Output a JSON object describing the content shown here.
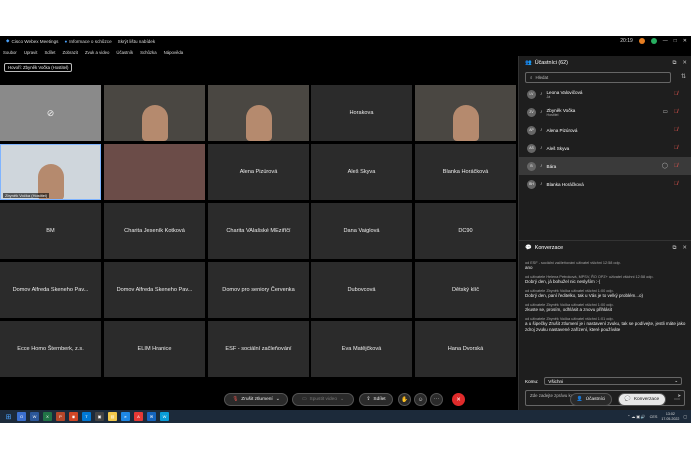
{
  "window": {
    "title": "Cisco Webex Meetings",
    "meeting_info": "Informace o schůzce",
    "hide_bar": "Skrýt lištu nabídek",
    "time": "20:19"
  },
  "menu": [
    "Soubor",
    "Upravit",
    "Sdílet",
    "Zobrazit",
    "Zvuk a video",
    "Účastník",
    "Schůzka",
    "Nápověda"
  ],
  "speaker_badge": "Hovoří: Zbyněk Vočka (Hostitel)",
  "tiles": [
    {
      "label": "",
      "type": "video-off"
    },
    {
      "label": "",
      "type": "video"
    },
    {
      "label": "",
      "type": "video"
    },
    {
      "label": "Horakova",
      "type": "name"
    },
    {
      "label": "",
      "type": "video"
    },
    {
      "label": "Zbyněk Vočka (Hostitel)",
      "type": "video-active"
    },
    {
      "label": "",
      "type": "blurred"
    },
    {
      "label": "Alena Pizúrová",
      "type": "name"
    },
    {
      "label": "Aleš Skyva",
      "type": "name"
    },
    {
      "label": "Blanka Horáčková",
      "type": "name"
    },
    {
      "label": "BM",
      "type": "name"
    },
    {
      "label": "Charita Jeseník Kotková",
      "type": "name"
    },
    {
      "label": "Charita VAlašské MEziříčí",
      "type": "name"
    },
    {
      "label": "Dana Vaiglová",
      "type": "name"
    },
    {
      "label": "DC90",
      "type": "name"
    },
    {
      "label": "Domov Alfreda Skeneho Pav...",
      "type": "name"
    },
    {
      "label": "Domov Alfreda Skeneho Pav...",
      "type": "name"
    },
    {
      "label": "Domov pro seniory Červenka",
      "type": "name"
    },
    {
      "label": "Dubovcová",
      "type": "name"
    },
    {
      "label": "Dětský klíč",
      "type": "name"
    },
    {
      "label": "Ecce Homo Šternberk, z.s.",
      "type": "name"
    },
    {
      "label": "ELIM Hranice",
      "type": "name"
    },
    {
      "label": "ESF - sociální začleňování",
      "type": "name"
    },
    {
      "label": "Eva Matějčková",
      "type": "name"
    },
    {
      "label": "Hana Dvorská",
      "type": "name"
    }
  ],
  "participants_panel": {
    "title": "Účastníci (62)",
    "search_placeholder": "Hledat",
    "items": [
      {
        "initials": "LV",
        "name": "Leona Valovičová",
        "sub": "Já"
      },
      {
        "initials": "ZV",
        "name": "Zbyněk Vočka",
        "sub": "Hostitel"
      },
      {
        "initials": "AP",
        "name": "Alena Pizúrová",
        "sub": ""
      },
      {
        "initials": "AS",
        "name": "Aleš Skyva",
        "sub": ""
      },
      {
        "initials": "B",
        "name": "Bára",
        "sub": ""
      },
      {
        "initials": "BH",
        "name": "Blanka Horáčková",
        "sub": ""
      }
    ]
  },
  "chat": {
    "title": "Konverzace",
    "messages": [
      {
        "meta": "od ESF - sociální začleňování uživatel všichni    12:58 odp.",
        "text": "ano"
      },
      {
        "meta": "od uživatele Helena Petroková, MPSV, ŘO OPZ+ uživatel všichni 12:58 odp.",
        "text": "Dobrý den, já bohužel nic neslyším :-("
      },
      {
        "meta": "od uživatele Zbyněk Vočka uživatel všichni    1:00 odp.",
        "text": "Dobrý den, paní ředitelko, tak u Vás je to velký problém...o)"
      },
      {
        "meta": "od uživatele Zbyněk Vočka uživatel všichni    1:00 odp.",
        "text": "zkuste se, prosím, odhlásit a znovu přihlásit"
      },
      {
        "meta": "od uživatele Zbyněk Vočka uživatel všichni    1:01 odp.",
        "text": "a u šipečky Zrušit ztlumení je i nastavení zvuku, tak se podívejte, jestli máte jako zdroj zvuku nastavené zařízení, které používáte"
      }
    ],
    "to_label": "Komu:",
    "to_value": "Všichni",
    "input_placeholder": "Zde zadejte zprávu konverzace"
  },
  "controls": {
    "unmute": "Zrušit ztlumení",
    "start_video": "Spustit video",
    "share": "Sdílet",
    "participants": "Účastníci",
    "chat": "Konverzace"
  },
  "taskbar": {
    "time": "13:02",
    "date": "17.05.2022",
    "lang": "CES"
  },
  "colors": {
    "accent": "#e02b2b",
    "active_border": "#7fb4ff"
  }
}
